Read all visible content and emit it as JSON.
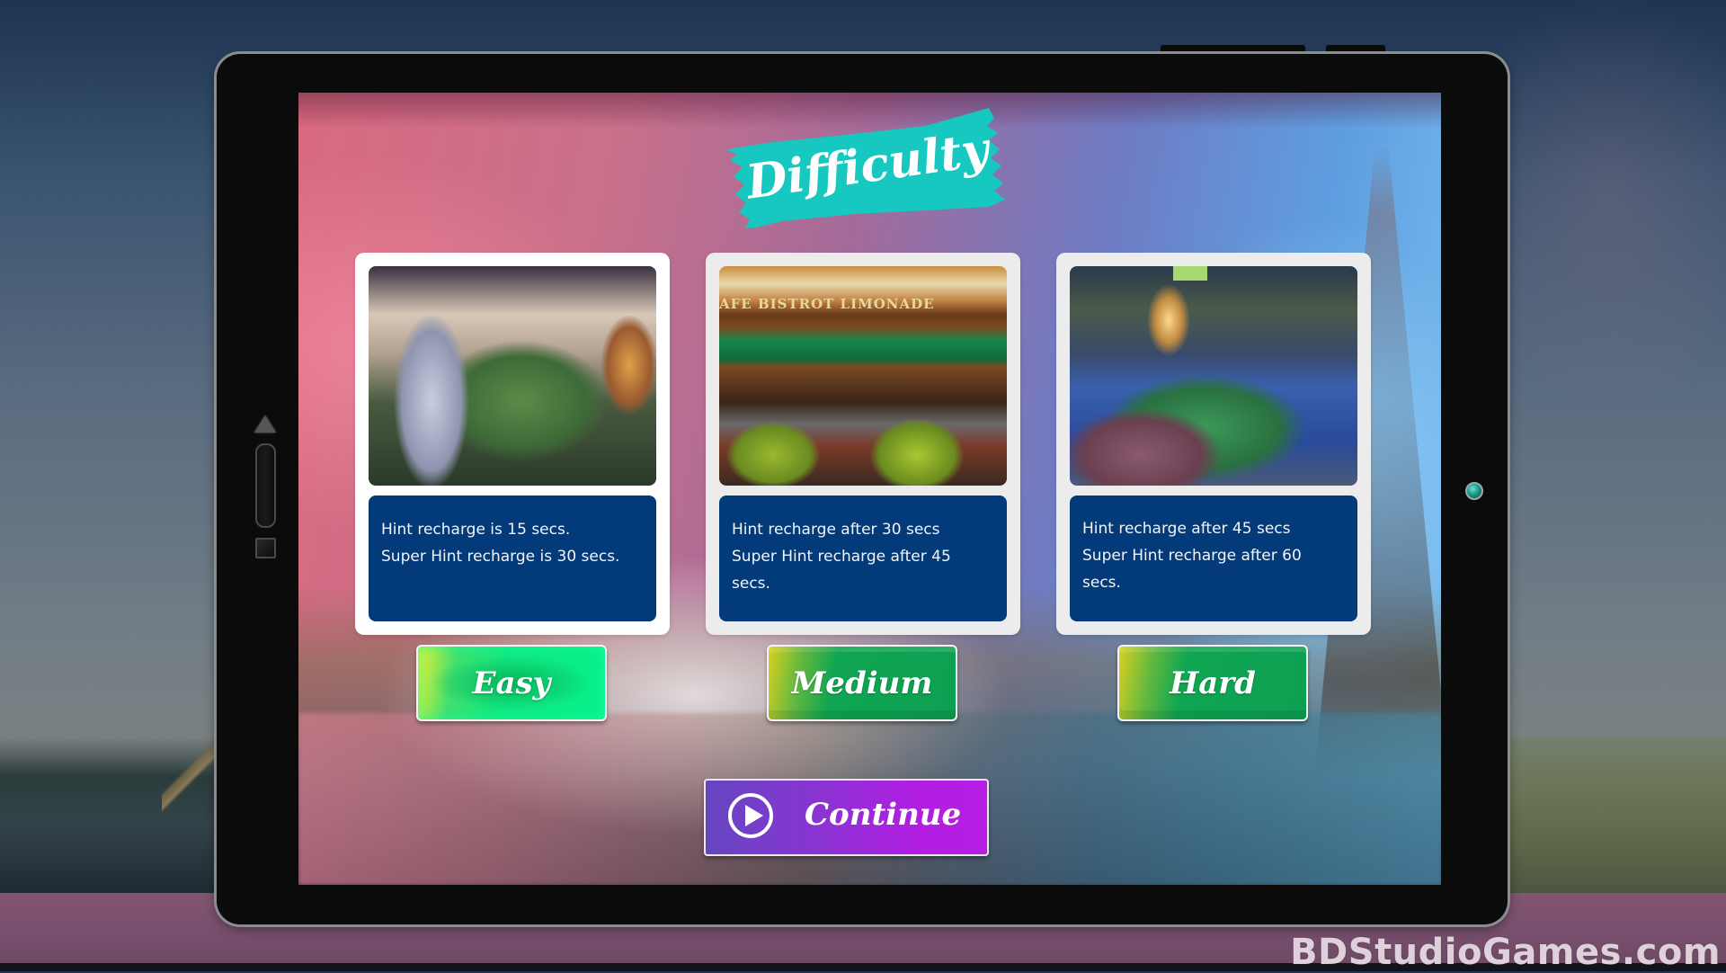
{
  "title": "Difficulty",
  "colors": {
    "ribbon": "#17c8c0",
    "card_desc_bg": "#033a7a",
    "difficulty_button": "#0ea052",
    "continue_start": "#6446c0",
    "continue_end": "#b61ee4",
    "camera": "#1a9a8a"
  },
  "cards": [
    {
      "id": "easy",
      "image": "statue-flower-alley",
      "lines": [
        "Hint recharge is 15 secs.",
        "Super Hint recharge is 30 secs."
      ],
      "button_label": "Easy",
      "selected": true
    },
    {
      "id": "medium",
      "image": "cafe-bistrot",
      "image_sign": "AFE   BISTROT   LIMONADE",
      "lines": [
        "Hint recharge after 30 secs",
        "Super Hint recharge after 45 secs."
      ],
      "button_label": "Medium",
      "selected": false
    },
    {
      "id": "hard",
      "image": "night-canal-plants",
      "lines": [
        "Hint recharge after 45 secs",
        "Super Hint recharge after 60 secs."
      ],
      "button_label": "Hard",
      "selected": false
    }
  ],
  "continue": {
    "label": "Continue",
    "icon": "play-circle-icon"
  },
  "tablet": {
    "side_controls": [
      "arrow-up-icon",
      "slider-pill",
      "square-icon"
    ],
    "camera": "camera-lens-icon"
  },
  "watermark": "BDStudioGames.com"
}
